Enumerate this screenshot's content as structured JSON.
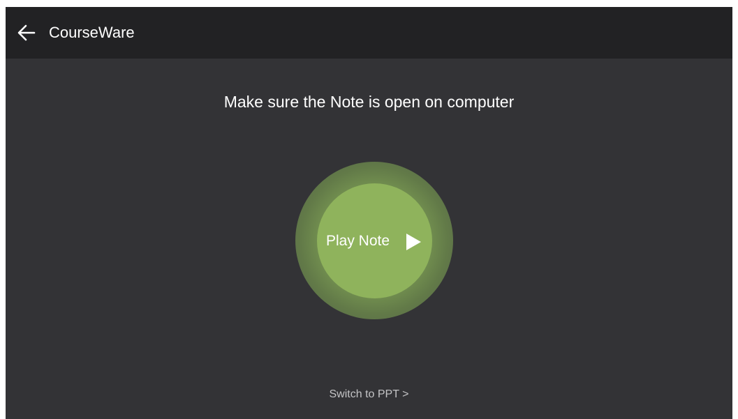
{
  "header": {
    "title": "CourseWare",
    "back_icon": "arrow-left-icon"
  },
  "main": {
    "instruction": "Make sure the Note is open on computer",
    "play_button": {
      "label": "Play Note",
      "icon": "play-triangle-icon",
      "color": "#8fb35c"
    },
    "switch_link": "Switch to PPT >"
  },
  "colors": {
    "background": "#333336",
    "header_background": "#222224",
    "accent": "#8fb35c"
  }
}
